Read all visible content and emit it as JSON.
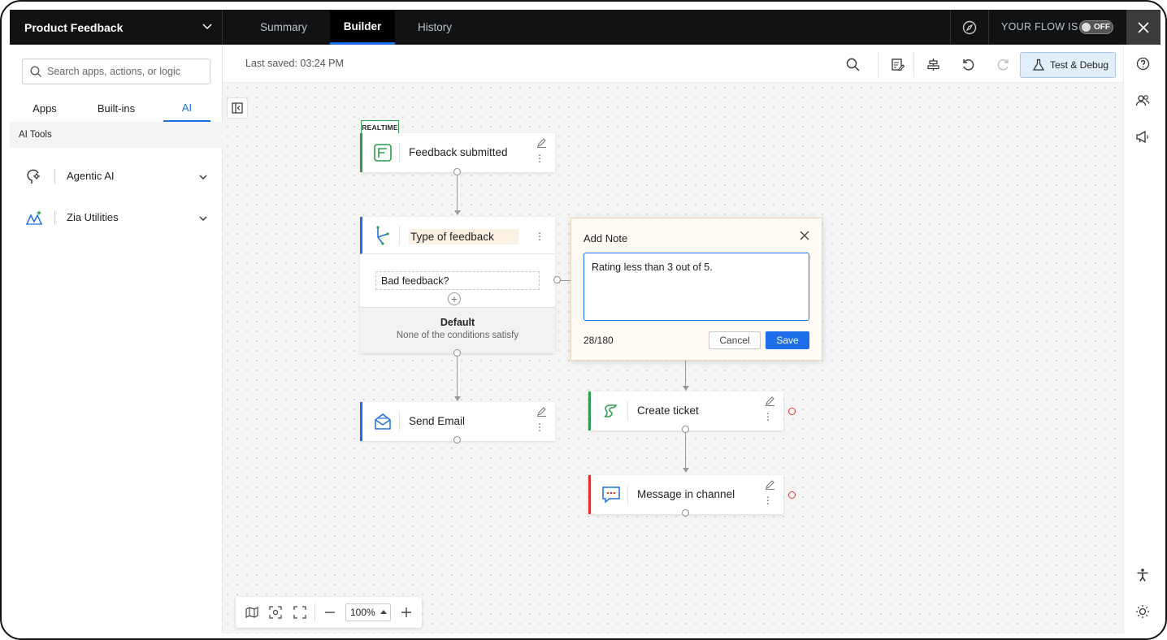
{
  "topbar": {
    "flow_name": "Product Feedback",
    "tabs": [
      "Summary",
      "Builder",
      "History"
    ],
    "active_tab": "Builder",
    "flow_status_label": "YOUR FLOW IS",
    "toggle_state": "OFF"
  },
  "sidebar": {
    "search_placeholder": "Search apps, actions, or logic",
    "tabs": [
      "Apps",
      "Built-ins",
      "AI"
    ],
    "active_tab": "AI",
    "section_title": "AI Tools",
    "tools": [
      {
        "label": "Agentic AI",
        "icon": "agentic-ai-icon"
      },
      {
        "label": "Zia Utilities",
        "icon": "zia-utilities-icon"
      }
    ]
  },
  "canvas_header": {
    "last_saved": "Last saved: 03:24 PM",
    "test_debug_label": "Test & Debug"
  },
  "nodes": {
    "trigger_badge": "REALTIME",
    "trigger": "Feedback submitted",
    "decision": "Type of feedback",
    "condition": "Bad feedback?",
    "default_title": "Default",
    "default_subtitle": "None of the conditions satisfy",
    "send_email": "Send Email",
    "create_ticket": "Create ticket",
    "message_channel": "Message in channel"
  },
  "note": {
    "title": "Add Note",
    "text": "Rating less than 3 out of 5.",
    "count": "28/180",
    "cancel_label": "Cancel",
    "save_label": "Save"
  },
  "zoom": {
    "level": "100%"
  },
  "colors": {
    "accent": "#1c6fe8",
    "trigger_green": "#2e9b4f",
    "alert_red": "#e03131"
  }
}
